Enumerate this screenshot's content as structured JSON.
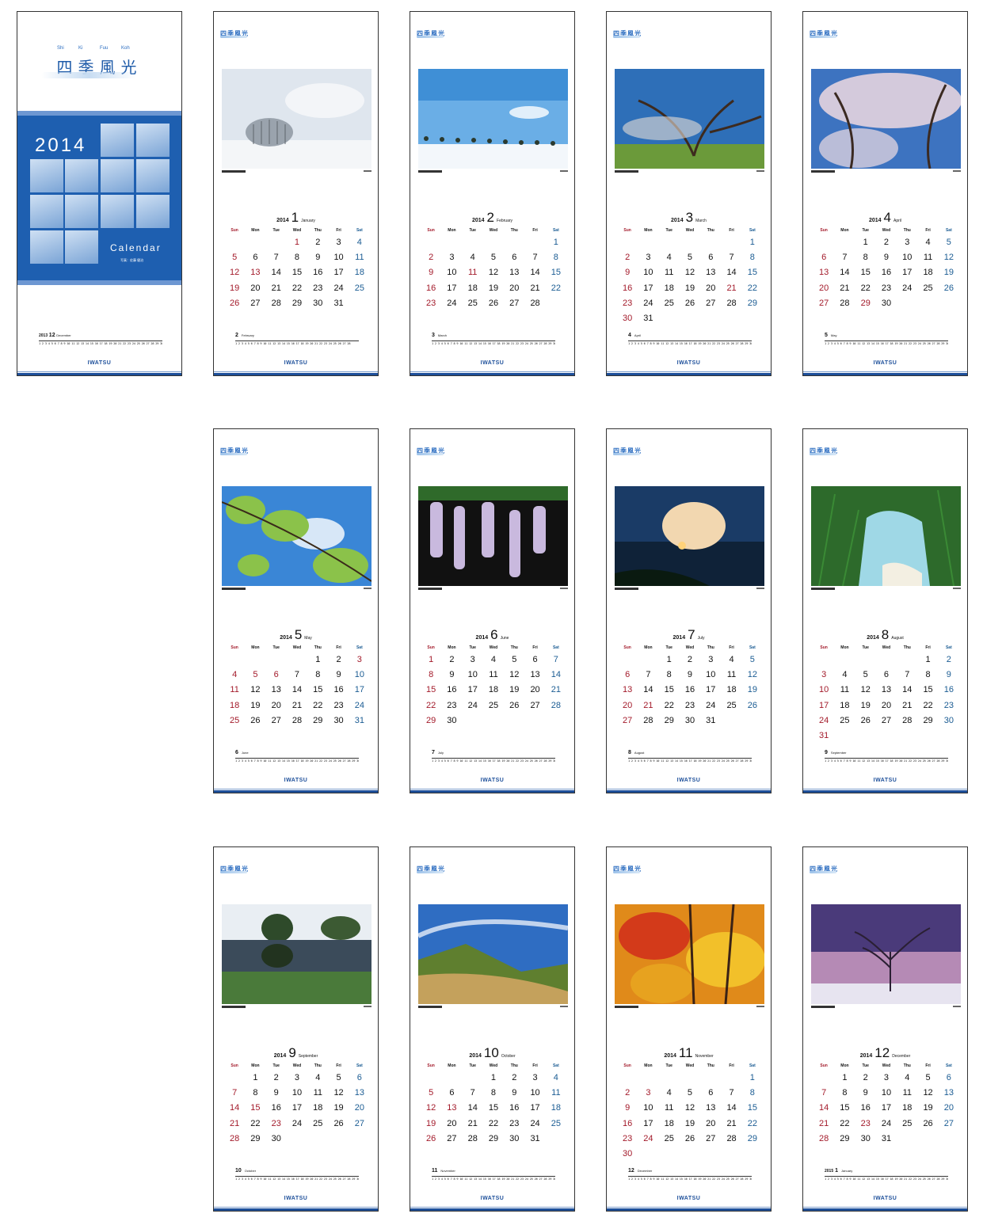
{
  "brand_label": "四季風光",
  "logo": "IWATSU",
  "cover": {
    "title": "四季風光",
    "romaji": [
      "Shi",
      "Ki",
      "Fuu",
      "Koh"
    ],
    "year": "2014",
    "calendar_label": "Calendar",
    "photo_credit": "写真：佐藤 健治",
    "footer_month_year": "2013",
    "footer_month": "12",
    "footer_month_en": "December",
    "footer_days": "1 2 3 4 5 6 7 8 9 10 11 12 13 14 15 16 17 18 19 20 21 22 23 24 25 26 27 28 29 30 31"
  },
  "weekdays": [
    "Sun",
    "Mon",
    "Tue",
    "Wed",
    "Thu",
    "Fri",
    "Sat"
  ],
  "colors": {
    "sunday": "#a31a2a",
    "saturday": "#1b5c93",
    "accent": "#1d4f9a"
  },
  "months": [
    {
      "year": "2014",
      "num": "1",
      "en": "January",
      "offset": 3,
      "days": 31,
      "holidays": [
        1,
        13
      ],
      "next_num": "2",
      "next_en": "February",
      "next_days": "1 2 3 4 5 6 7 8 9 10 11 12 13 14 15 16 17 18 19 20 21 22 23 24 25 26 27 28",
      "photo": "winter-trees"
    },
    {
      "year": "2014",
      "num": "2",
      "en": "February",
      "offset": 6,
      "days": 28,
      "holidays": [
        11
      ],
      "next_num": "3",
      "next_en": "March",
      "next_days": "1 2 3 4 5 6 7 8 9 10 11 12 13 14 15 16 17 18 19 20 21 22 23 24 25 26 27 28 29 30 31",
      "photo": "snow-row"
    },
    {
      "year": "2014",
      "num": "3",
      "en": "March",
      "offset": 6,
      "days": 31,
      "holidays": [
        21
      ],
      "next_num": "4",
      "next_en": "April",
      "next_days": "1 2 3 4 5 6 7 8 9 10 11 12 13 14 15 16 17 18 19 20 21 22 23 24 25 26 27 28 29 30",
      "photo": "plum-tree"
    },
    {
      "year": "2014",
      "num": "4",
      "en": "April",
      "offset": 2,
      "days": 30,
      "holidays": [
        29
      ],
      "next_num": "5",
      "next_en": "May",
      "next_days": "1 2 3 4 5 6 7 8 9 10 11 12 13 14 15 16 17 18 19 20 21 22 23 24 25 26 27 28 29 30 31",
      "photo": "cherry"
    },
    {
      "year": "2014",
      "num": "5",
      "en": "May",
      "offset": 4,
      "days": 31,
      "holidays": [
        3,
        5,
        6
      ],
      "next_num": "6",
      "next_en": "June",
      "next_days": "1 2 3 4 5 6 7 8 9 10 11 12 13 14 15 16 17 18 19 20 21 22 23 24 25 26 27 28 29 30",
      "photo": "green-leaves"
    },
    {
      "year": "2014",
      "num": "6",
      "en": "June",
      "offset": 0,
      "days": 30,
      "holidays": [],
      "next_num": "7",
      "next_en": "July",
      "next_days": "1 2 3 4 5 6 7 8 9 10 11 12 13 14 15 16 17 18 19 20 21 22 23 24 25 26 27 28 29 30 31",
      "photo": "wisteria"
    },
    {
      "year": "2014",
      "num": "7",
      "en": "July",
      "offset": 2,
      "days": 31,
      "holidays": [
        21
      ],
      "next_num": "8",
      "next_en": "August",
      "next_days": "1 2 3 4 5 6 7 8 9 10 11 12 13 14 15 16 17 18 19 20 21 22 23 24 25 26 27 28 29 30 31",
      "photo": "sunset-sea"
    },
    {
      "year": "2014",
      "num": "8",
      "en": "August",
      "offset": 5,
      "days": 31,
      "holidays": [],
      "next_num": "9",
      "next_en": "September",
      "next_days": "1 2 3 4 5 6 7 8 9 10 11 12 13 14 15 16 17 18 19 20 21 22 23 24 25 26 27 28 29 30",
      "photo": "beach-grass"
    },
    {
      "year": "2014",
      "num": "9",
      "en": "September",
      "offset": 1,
      "days": 30,
      "holidays": [
        15,
        23
      ],
      "next_num": "10",
      "next_en": "October",
      "next_days": "1 2 3 4 5 6 7 8 9 10 11 12 13 14 15 16 17 18 19 20 21 22 23 24 25 26 27 28 29 30 31",
      "photo": "pond"
    },
    {
      "year": "2014",
      "num": "10",
      "en": "October",
      "offset": 3,
      "days": 31,
      "holidays": [
        13
      ],
      "next_num": "11",
      "next_en": "November",
      "next_days": "1 2 3 4 5 6 7 8 9 10 11 12 13 14 15 16 17 18 19 20 21 22 23 24 25 26 27 28 29 30",
      "photo": "autumn-hill"
    },
    {
      "year": "2014",
      "num": "11",
      "en": "November",
      "offset": 6,
      "days": 30,
      "holidays": [
        3,
        24
      ],
      "next_num": "12",
      "next_en": "December",
      "next_days": "1 2 3 4 5 6 7 8 9 10 11 12 13 14 15 16 17 18 19 20 21 22 23 24 25 26 27 28 29 30 31",
      "photo": "maple"
    },
    {
      "year": "2014",
      "num": "12",
      "en": "December",
      "offset": 1,
      "days": 31,
      "holidays": [
        23
      ],
      "next_num": "1",
      "next_en": "January",
      "next_year": "2015",
      "next_days": "1 2 3 4 5 6 7 8 9 10 11 12 13 14 15 16 17 18 19 20 21 22 23 24 25 26 27 28 29 30 31",
      "photo": "dusk-tree"
    }
  ]
}
